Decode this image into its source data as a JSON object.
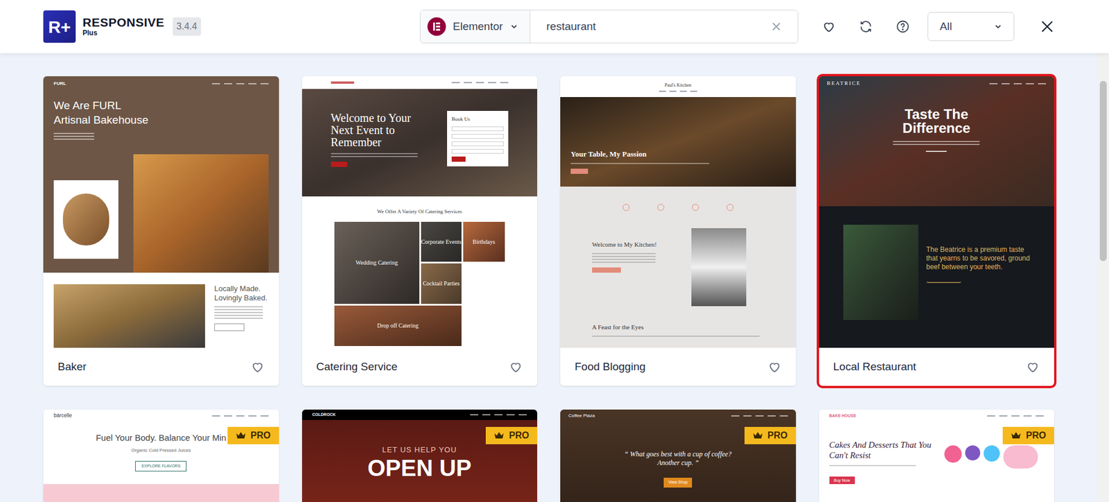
{
  "app": {
    "logo_mark": "R+",
    "name": "RESPONSIVE",
    "sub": "Plus",
    "version": "3.4.4"
  },
  "builder": {
    "label": "Elementor"
  },
  "search": {
    "value": "restaurant"
  },
  "filter": {
    "label": "All"
  },
  "cards": [
    {
      "title": "Baker",
      "favorite": false,
      "selected": false,
      "pro": false,
      "kind": "bakery",
      "preview": {
        "logo": "FURL",
        "headline": [
          "We Are FURL",
          "Artisnal Bakehouse"
        ],
        "tagline": [
          "Locally Made.",
          "Lovingly Baked."
        ]
      }
    },
    {
      "title": "Catering Service",
      "favorite": false,
      "selected": false,
      "pro": false,
      "kind": "catering",
      "preview": {
        "headline": "Welcome to Your Next Event to Remember",
        "form_title": "Book Us",
        "section_title": "We Offer A Variety Of Catering Services",
        "tiles": [
          "Wedding Catering",
          "Corporate Events",
          "Birthdays",
          "Cocktail Parties",
          "Drop off Catering"
        ]
      }
    },
    {
      "title": "Food Blogging",
      "favorite": false,
      "selected": false,
      "pro": false,
      "kind": "blog",
      "preview": {
        "logo": "Paul's Kitchen",
        "headline": "Your Table, My Passion",
        "welcome": "Welcome to My Kitchen!",
        "feast": "A Feast for the Eyes"
      }
    },
    {
      "title": "Local Restaurant",
      "favorite": false,
      "selected": true,
      "pro": false,
      "kind": "restaurant",
      "preview": {
        "logo": "BEATRICE",
        "headline": [
          "Taste The",
          "Difference"
        ],
        "body": "The Beatrice is a premium taste that yearns to be savored, ground beef between your teeth."
      }
    },
    {
      "pro": true,
      "pro_label": "PRO",
      "selected": false,
      "kind": "juice",
      "preview": {
        "logo": "bärcelle",
        "headline": "Fuel Your Body. Balance Your Min",
        "sub": "Organic Cold Pressed Juices",
        "button": "EXPLORE FLAVORS"
      }
    },
    {
      "pro": true,
      "pro_label": "PRO",
      "selected": false,
      "kind": "bar",
      "preview": {
        "logo": "COLDROCK",
        "kicker": "LET US HELP YOU",
        "headline": "OPEN UP"
      }
    },
    {
      "pro": true,
      "pro_label": "PRO",
      "selected": false,
      "kind": "coffee",
      "preview": {
        "logo": "Coffee Plaza",
        "quote": "“ What goes best with a cup of coffee? Another cup. ”",
        "button": "View Shop"
      }
    },
    {
      "pro": true,
      "pro_label": "PRO",
      "selected": false,
      "kind": "dessert",
      "preview": {
        "logo": "BAKE HOUSE",
        "headline": "Cakes And Desserts That You Can't Resist",
        "button": "Buy Now"
      }
    }
  ]
}
